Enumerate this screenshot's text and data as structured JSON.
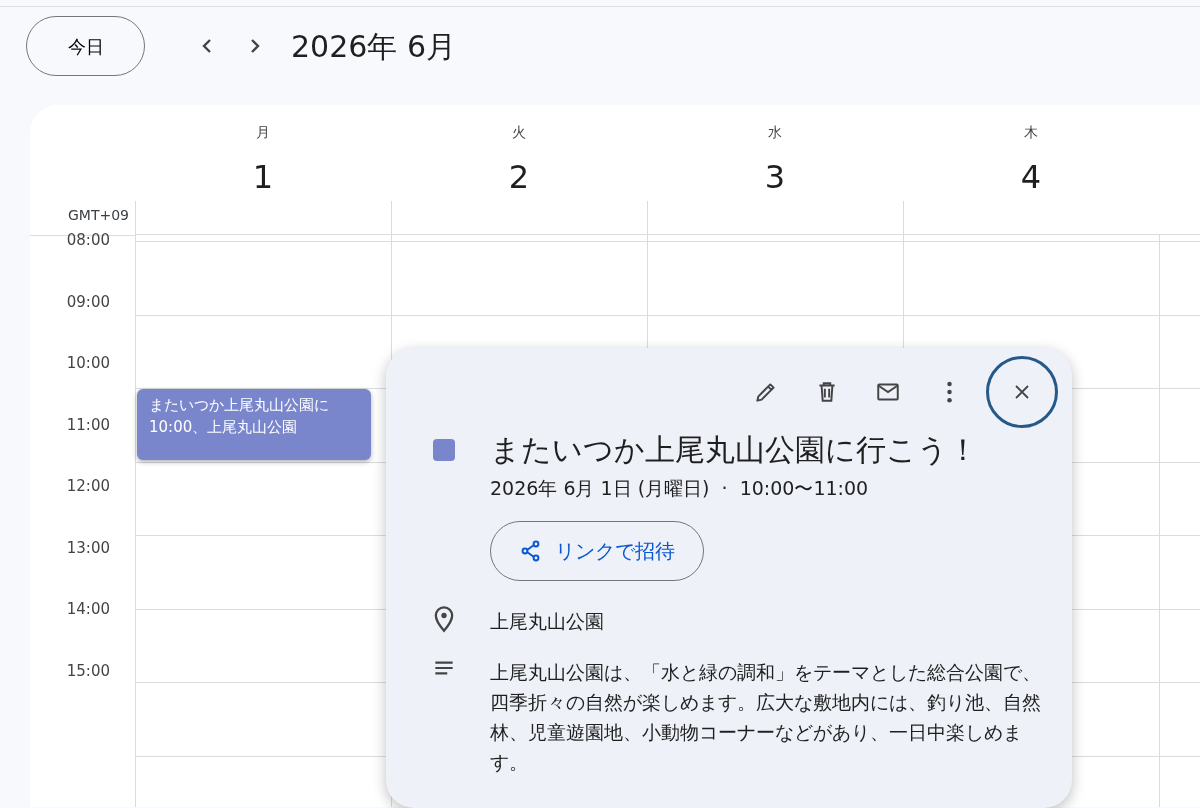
{
  "toolbar": {
    "today_button": "今日",
    "title": "2026年 6月"
  },
  "timezone": "GMT+09",
  "days": [
    {
      "weekday": "月",
      "date": "1",
      "events": [
        {
          "title": "またいつか上尾丸山公園に",
          "detail": "10:00、上尾丸山公園",
          "color": "#7986cb"
        }
      ]
    },
    {
      "weekday": "火",
      "date": "2"
    },
    {
      "weekday": "水",
      "date": "3"
    },
    {
      "weekday": "木",
      "date": "4"
    }
  ],
  "hours": [
    "08:00",
    "09:00",
    "10:00",
    "11:00",
    "12:00",
    "13:00",
    "14:00",
    "15:00"
  ],
  "popup": {
    "close_focused": true,
    "color": "#7986cb",
    "title": "またいつか上尾丸山公園に行こう！",
    "date_time": "2026年 6月 1日 (月曜日)  ·  10:00〜11:00",
    "invite_button": "リンクで招待",
    "location": "上尾丸山公園",
    "description": "上尾丸山公園は、「水と緑の調和」をテーマとした総合公園で、四季折々の自然が楽しめます。広大な敷地内には、釣り池、自然林、児童遊園地、小動物コーナーなどがあり、一日中楽しめます。"
  }
}
